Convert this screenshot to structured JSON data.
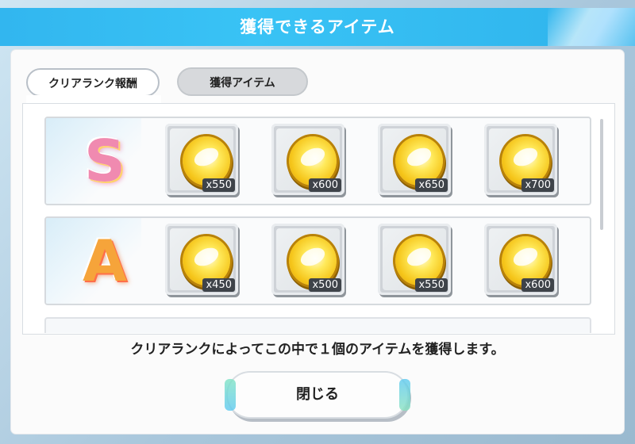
{
  "dialog": {
    "title": "獲得できるアイテム",
    "tabs": [
      {
        "label": "クリアランク報酬",
        "active": true
      },
      {
        "label": "獲得アイテム",
        "active": false
      }
    ],
    "rows": [
      {
        "rank": "S",
        "items": [
          {
            "icon": "gold-coin-icon",
            "quantity": "x550"
          },
          {
            "icon": "gold-coin-icon",
            "quantity": "x600"
          },
          {
            "icon": "gold-coin-icon",
            "quantity": "x650"
          },
          {
            "icon": "gold-coin-icon",
            "quantity": "x700"
          }
        ]
      },
      {
        "rank": "A",
        "items": [
          {
            "icon": "gold-coin-icon",
            "quantity": "x450"
          },
          {
            "icon": "gold-coin-icon",
            "quantity": "x500"
          },
          {
            "icon": "gold-coin-icon",
            "quantity": "x550"
          },
          {
            "icon": "gold-coin-icon",
            "quantity": "x600"
          }
        ]
      }
    ],
    "message": "クリアランクによってこの中で１個のアイテムを獲得します。",
    "close_label": "閉じる"
  },
  "colors": {
    "title_bar": "#39c3f5",
    "rank_s": "#f08ab0",
    "rank_a": "#f6a43a",
    "coin": "#f5c51a"
  }
}
